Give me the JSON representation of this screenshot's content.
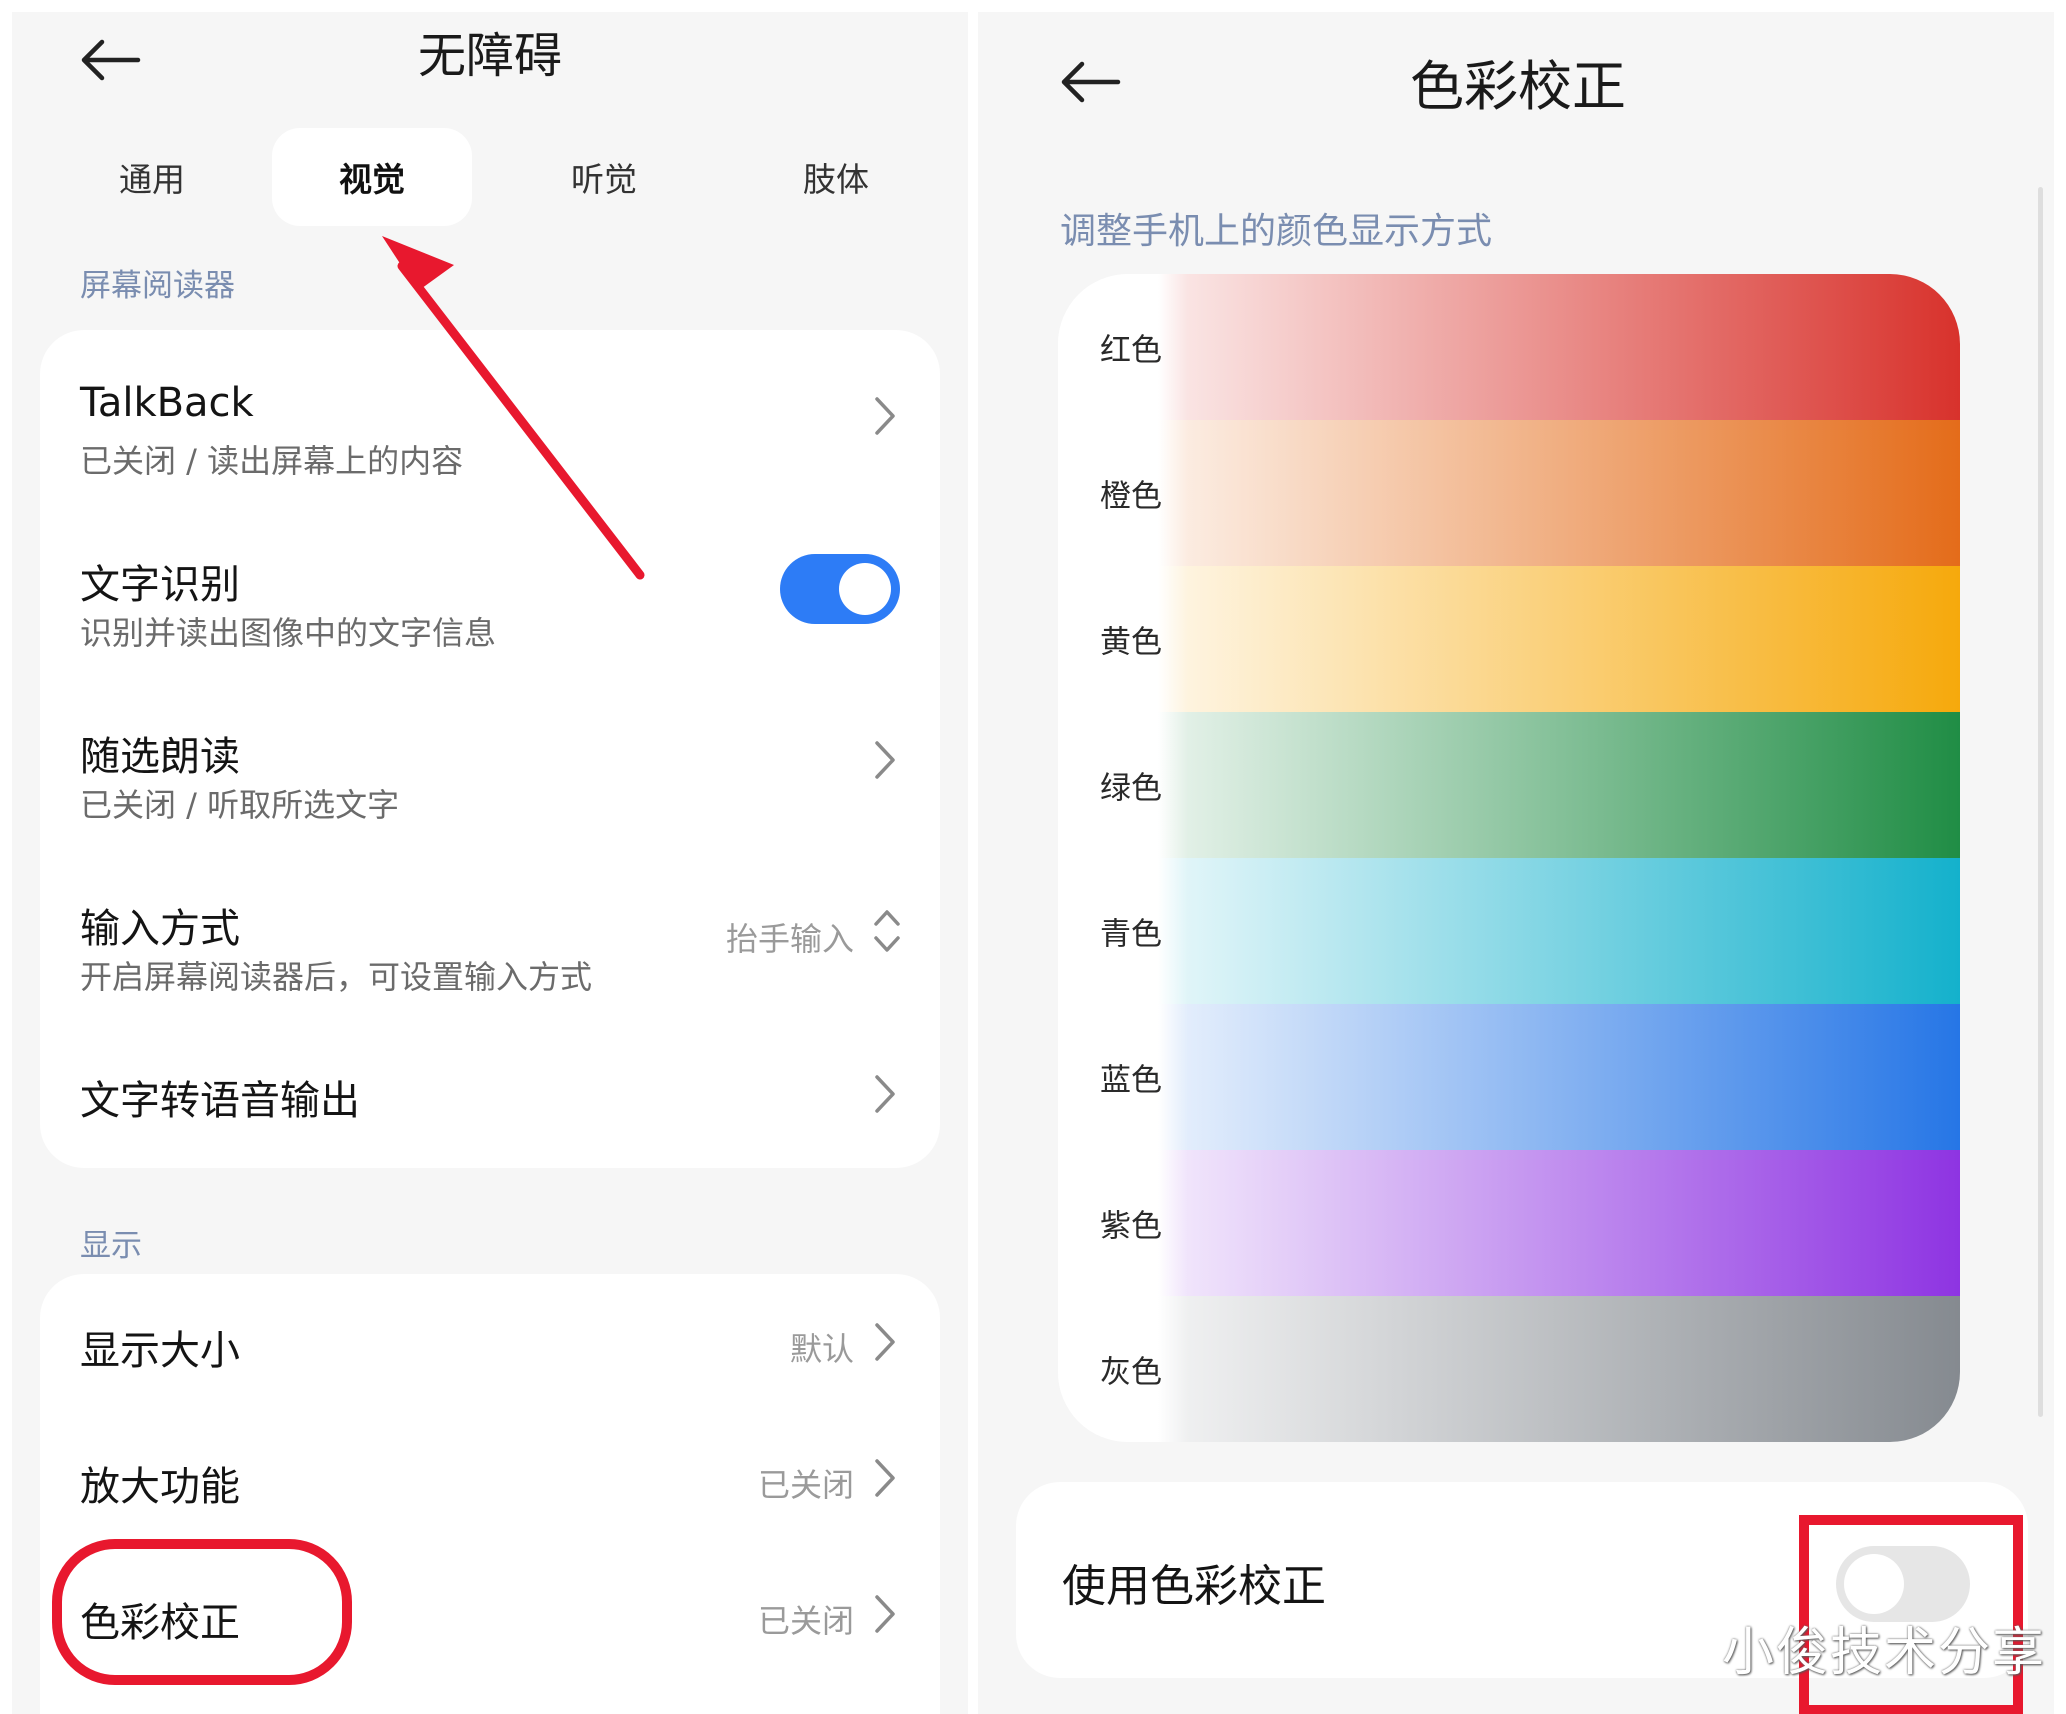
{
  "left": {
    "title": "无障碍",
    "tabs": [
      {
        "label": "通用",
        "active": false
      },
      {
        "label": "视觉",
        "active": true
      },
      {
        "label": "听觉",
        "active": false
      },
      {
        "label": "肢体",
        "active": false
      }
    ],
    "section_screen_reader": "屏幕阅读器",
    "talkback": {
      "title": "TalkBack",
      "subtitle": "已关闭 / 读出屏幕上的内容"
    },
    "text_recognition": {
      "title": "文字识别",
      "subtitle": "识别并读出图像中的文字信息",
      "enabled": true
    },
    "select_to_speak": {
      "title": "随选朗读",
      "subtitle": "已关闭 / 听取所选文字"
    },
    "input_method": {
      "title": "输入方式",
      "subtitle": "开启屏幕阅读器后，可设置输入方式",
      "value": "抬手输入"
    },
    "tts_output": {
      "title": "文字转语音输出"
    },
    "section_display": "显示",
    "display_size": {
      "title": "显示大小",
      "value": "默认"
    },
    "magnification": {
      "title": "放大功能",
      "value": "已关闭"
    },
    "color_correction": {
      "title": "色彩校正",
      "value": "已关闭"
    }
  },
  "right": {
    "title": "色彩校正",
    "description": "调整手机上的颜色显示方式",
    "colors": [
      {
        "label": "红色",
        "color": "#d8322c"
      },
      {
        "label": "橙色",
        "color": "#e46c1a"
      },
      {
        "label": "黄色",
        "color": "#f6a90c"
      },
      {
        "label": "绿色",
        "color": "#208d45"
      },
      {
        "label": "青色",
        "color": "#14b1cc"
      },
      {
        "label": "蓝色",
        "color": "#2676e6"
      },
      {
        "label": "紫色",
        "color": "#8e34e2"
      },
      {
        "label": "灰色",
        "color": "#858a90"
      }
    ],
    "use_color_correction": {
      "label": "使用色彩校正",
      "enabled": false
    }
  },
  "colors": {
    "accent": "#2d7cf6",
    "annotation": "#e8182e"
  },
  "watermark": "小俊技术分享"
}
